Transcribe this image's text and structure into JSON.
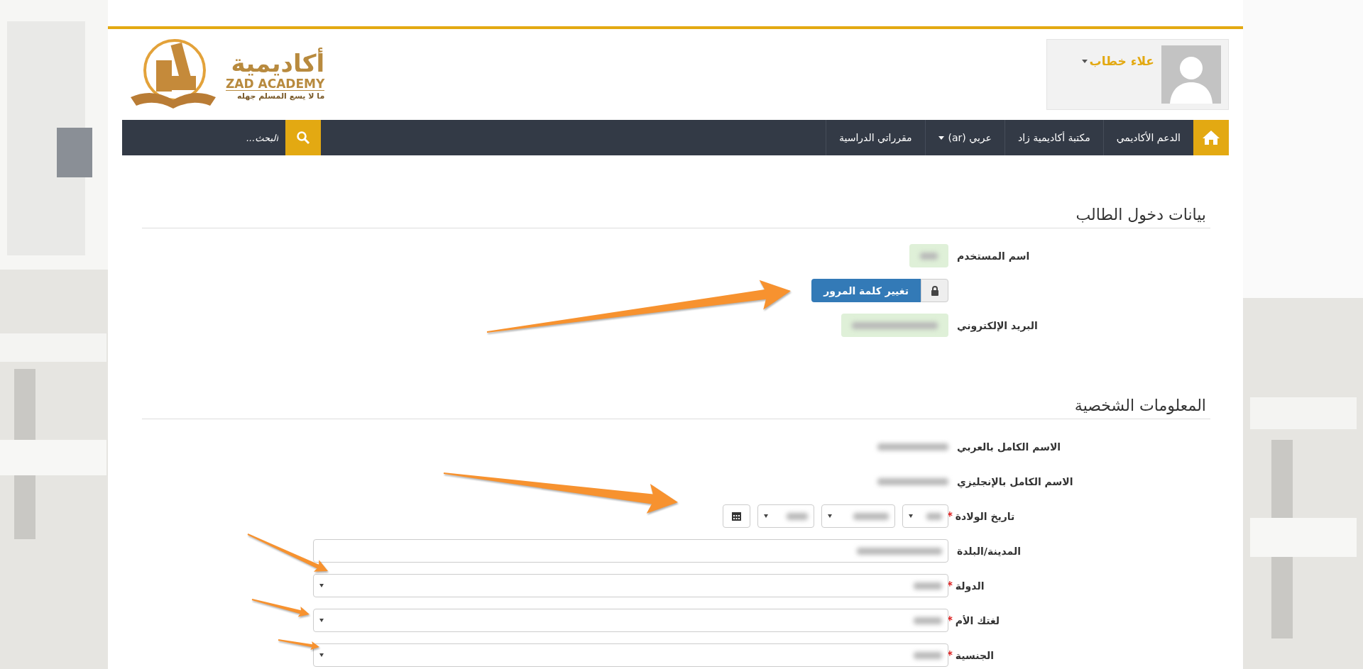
{
  "logo": {
    "arabic": "أكاديمية",
    "english": "ZAD ACADEMY",
    "tagline": "ما لا يسع المسلم جهله"
  },
  "user": {
    "name": "علاء خطاب"
  },
  "nav": {
    "items": [
      {
        "label": "الدعم الأكاديمي",
        "dropdown": false
      },
      {
        "label": "مكتبة أكاديمية زاد",
        "dropdown": false
      },
      {
        "label": "عربي ‎(ar)",
        "dropdown": true
      },
      {
        "label": "مقرراتي الدراسية",
        "dropdown": false
      }
    ],
    "search": {
      "placeholder": "البحث..."
    }
  },
  "sections": [
    {
      "title": "بيانات دخول الطالب",
      "fields": [
        {
          "kind": "readonly",
          "label": "اسم المستخدم"
        },
        {
          "kind": "button",
          "label": "تغيير كلمة المرور"
        },
        {
          "kind": "readonly",
          "label": "البريد الإلكتروني"
        }
      ]
    },
    {
      "title": "المعلومات الشخصية",
      "fields": [
        {
          "kind": "static",
          "label": "الاسم الكامل بالعربي"
        },
        {
          "kind": "static",
          "label": "الاسم الكامل بالإنجليزي"
        },
        {
          "kind": "date",
          "label": "تاريخ الولادة",
          "marker": "*"
        },
        {
          "kind": "input",
          "label": "المدينة/البلدة"
        },
        {
          "kind": "select",
          "label": "الدولة",
          "marker": "*"
        },
        {
          "kind": "select",
          "label": "لغتك الأم",
          "marker": "*"
        },
        {
          "kind": "select",
          "label": "الجنسية",
          "marker": "*"
        }
      ]
    }
  ]
}
